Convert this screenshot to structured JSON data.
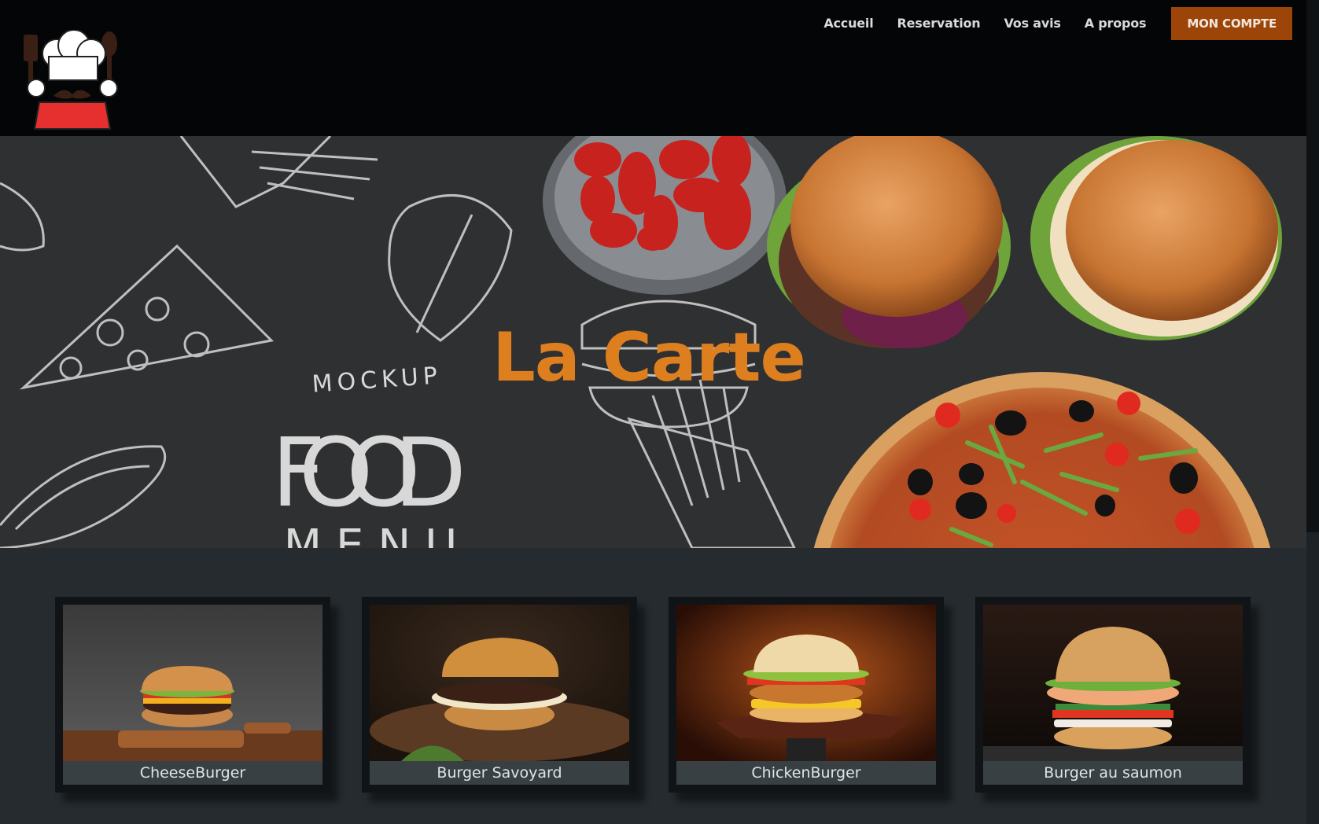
{
  "nav": {
    "links": [
      "Accueil",
      "Reservation",
      "Vos avis",
      "A propos"
    ],
    "account_button": "MON COMPTE"
  },
  "hero": {
    "title": "La Carte",
    "background_text_top": "MOCKUP",
    "background_text_main": "FOOD",
    "background_text_bottom": "MENU"
  },
  "menu_items": [
    {
      "name": "CheeseBurger"
    },
    {
      "name": "Burger Savoyard"
    },
    {
      "name": "ChickenBurger"
    },
    {
      "name": "Burger au saumon"
    }
  ],
  "colors": {
    "accent": "#dd7f1f",
    "button": "#9d4508",
    "header_bg": "#030507",
    "page_bg": "#252b2f"
  },
  "icons": {
    "logo": "chef-hat-logo-icon"
  }
}
